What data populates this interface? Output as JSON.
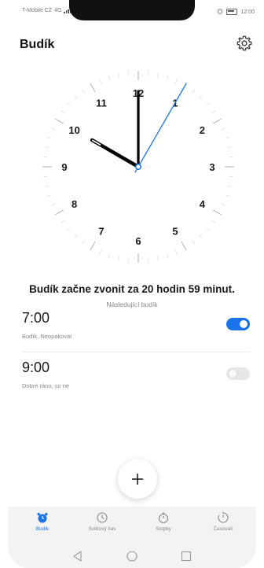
{
  "status_bar": {
    "carrier": "T-Mobile CZ",
    "network": "4G",
    "time": "12:00"
  },
  "header": {
    "title": "Budík",
    "settings_icon": "gear-icon"
  },
  "clock": {
    "numbers": [
      "12",
      "1",
      "2",
      "3",
      "4",
      "5",
      "6",
      "7",
      "8",
      "9",
      "10",
      "11"
    ],
    "time_hours": 10,
    "time_minutes": 0,
    "second_hand_position_seconds": 5,
    "hand_color": "#000000",
    "second_hand_color": "#1a73e8"
  },
  "info": {
    "ring_text": "Budík začne zvonit za 20 hodin 59 minut.",
    "next_alarm_label": "Následující budík"
  },
  "alarms": [
    {
      "time": "7:00",
      "subtitle": "Budík, Neopakovat",
      "enabled": true
    },
    {
      "time": "9:00",
      "subtitle": "Dobré ráno, so ne",
      "enabled": false
    }
  ],
  "add_button": {
    "icon": "plus-icon"
  },
  "tabs": [
    {
      "label": "Budík",
      "icon": "alarm-clock-icon",
      "active": true
    },
    {
      "label": "Světový čas",
      "icon": "world-clock-icon",
      "active": false
    },
    {
      "label": "Stopky",
      "icon": "stopwatch-icon",
      "active": false
    },
    {
      "label": "Časovač",
      "icon": "timer-icon",
      "active": false
    }
  ],
  "nav": {
    "back_icon": "back-triangle-icon",
    "home_icon": "home-circle-icon",
    "recents_icon": "recents-square-icon"
  },
  "colors": {
    "accent": "#1a73e8",
    "text_primary": "#1a1a1a",
    "text_secondary": "#888888"
  }
}
